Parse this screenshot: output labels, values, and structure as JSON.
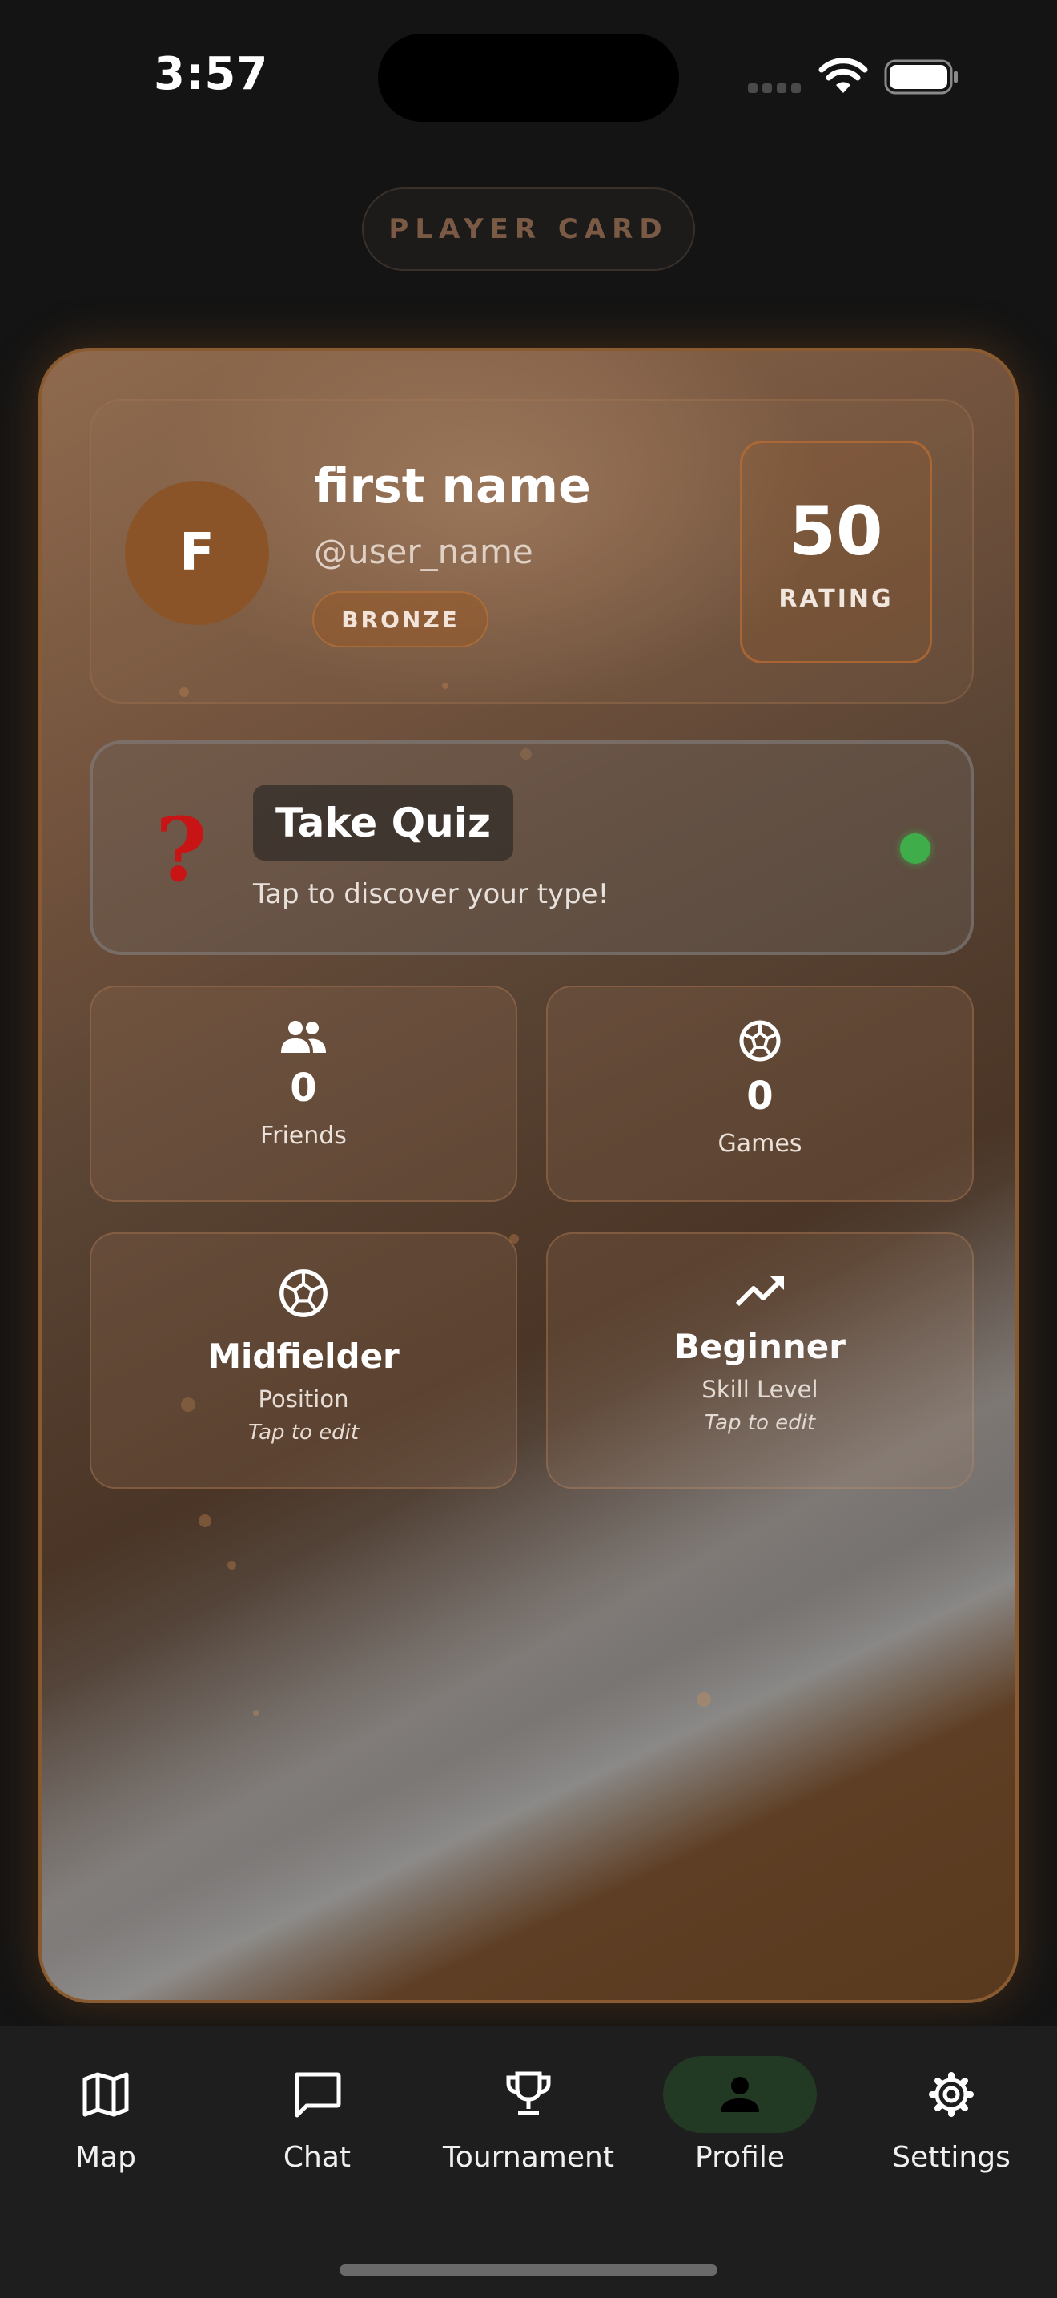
{
  "status_bar": {
    "time": "3:57"
  },
  "header": {
    "title": "PLAYER CARD"
  },
  "profile": {
    "avatar_initial": "F",
    "first_name": "first name",
    "username": "@user_name",
    "tier": "BRONZE",
    "rating_value": "50",
    "rating_label": "RATING"
  },
  "quiz": {
    "icon": "?",
    "title": "Take Quiz",
    "subtitle": "Tap to discover your type!"
  },
  "stats": [
    {
      "icon": "people-icon",
      "value": "0",
      "label": "Friends"
    },
    {
      "icon": "soccer-ball-icon",
      "value": "0",
      "label": "Games"
    }
  ],
  "attributes": [
    {
      "icon": "soccer-ball-icon",
      "title": "Midfielder",
      "label": "Position",
      "hint": "Tap to edit"
    },
    {
      "icon": "trending-up-icon",
      "title": "Beginner",
      "label": "Skill Level",
      "hint": "Tap to edit"
    }
  ],
  "nav": {
    "active": "Profile",
    "items": [
      {
        "label": "Map",
        "icon": "map-icon"
      },
      {
        "label": "Chat",
        "icon": "chat-icon"
      },
      {
        "label": "Tournament",
        "icon": "trophy-icon"
      },
      {
        "label": "Profile",
        "icon": "person-icon"
      },
      {
        "label": "Settings",
        "icon": "gear-icon"
      }
    ]
  },
  "colors": {
    "background": "#141414",
    "card_border": "#8a5a30",
    "quiz_icon": "#c81414",
    "status_dot": "#3fae4a",
    "nav_active": "#223a24"
  }
}
